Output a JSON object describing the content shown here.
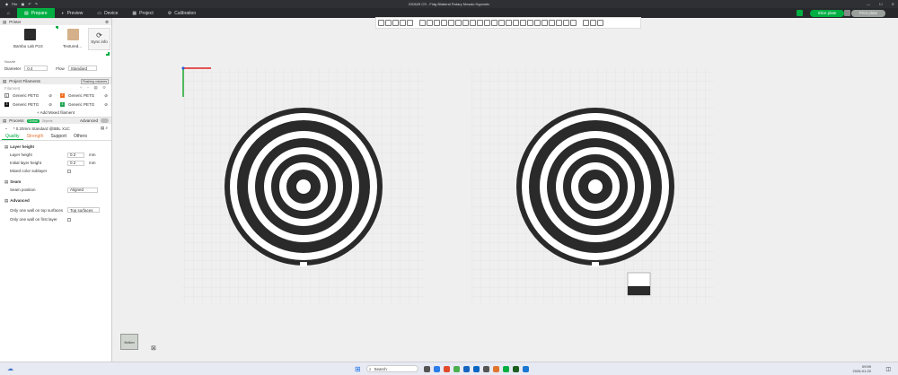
{
  "window": {
    "title": "220625 CS - Fidg Bilateral Rotary Mosaic Hypnotic",
    "menu_file": "File"
  },
  "nav": {
    "tabs": [
      "Prepare",
      "Preview",
      "Device",
      "Project",
      "Calibration"
    ],
    "slice_label": "Slice plate",
    "print_label": "Print plate"
  },
  "printer": {
    "section": "Printer",
    "name": "Bambu Lab P1S",
    "plate": "Textured...",
    "sync_label": "Sync info",
    "nozzle_label": "Nozzle",
    "diameter_label": "Diameter",
    "diameter_value": "0.4",
    "flow_label": "Flow",
    "flow_value": "Standard"
  },
  "filaments": {
    "section": "Project Filaments",
    "badge": "Flushing volumes",
    "group_label": "Filament",
    "items": [
      {
        "idx": "1",
        "name": "Generic PETG",
        "color": "#ffffff"
      },
      {
        "idx": "2",
        "name": "Generic PETG",
        "color": "#ef6a1a"
      },
      {
        "idx": "3",
        "name": "Generic PETG",
        "color": "#111111"
      },
      {
        "idx": "4",
        "name": "Generic PETG",
        "color": "#1ca24c"
      }
    ],
    "add_mixed": "+ Add Mixed filament"
  },
  "process": {
    "section": "Process",
    "toggle_a": "Global",
    "toggle_b": "Objects",
    "advanced": "Advanced",
    "preset": "* 0.20mm Standard @BBL X1C",
    "tabs": [
      "Quality",
      "Strength",
      "Support",
      "Others"
    ]
  },
  "quality": {
    "layer_height_group": "Layer height",
    "layer_height_label": "Layer height",
    "layer_height_value": "0.2",
    "layer_height_unit": "mm",
    "initial_layer_label": "Initial layer height",
    "initial_layer_value": "0.2",
    "initial_layer_unit": "mm",
    "mixed_color_label": "Mixed color sublayer",
    "seam_group": "Seam",
    "seam_position_label": "Seam position",
    "seam_position_value": "Aligned",
    "advanced_group": "Advanced",
    "one_wall_top_label": "Only one wall on top surfaces",
    "one_wall_top_value": "Top surfaces",
    "one_wall_first_label": "Only one wall on first layer"
  },
  "viewport": {
    "orient_label": "Bottom"
  },
  "taskbar": {
    "search": "Search",
    "time": "09:59",
    "date": "2026-01-20"
  },
  "colors": {
    "accent": "#00ae42",
    "dark": "#27292c"
  }
}
